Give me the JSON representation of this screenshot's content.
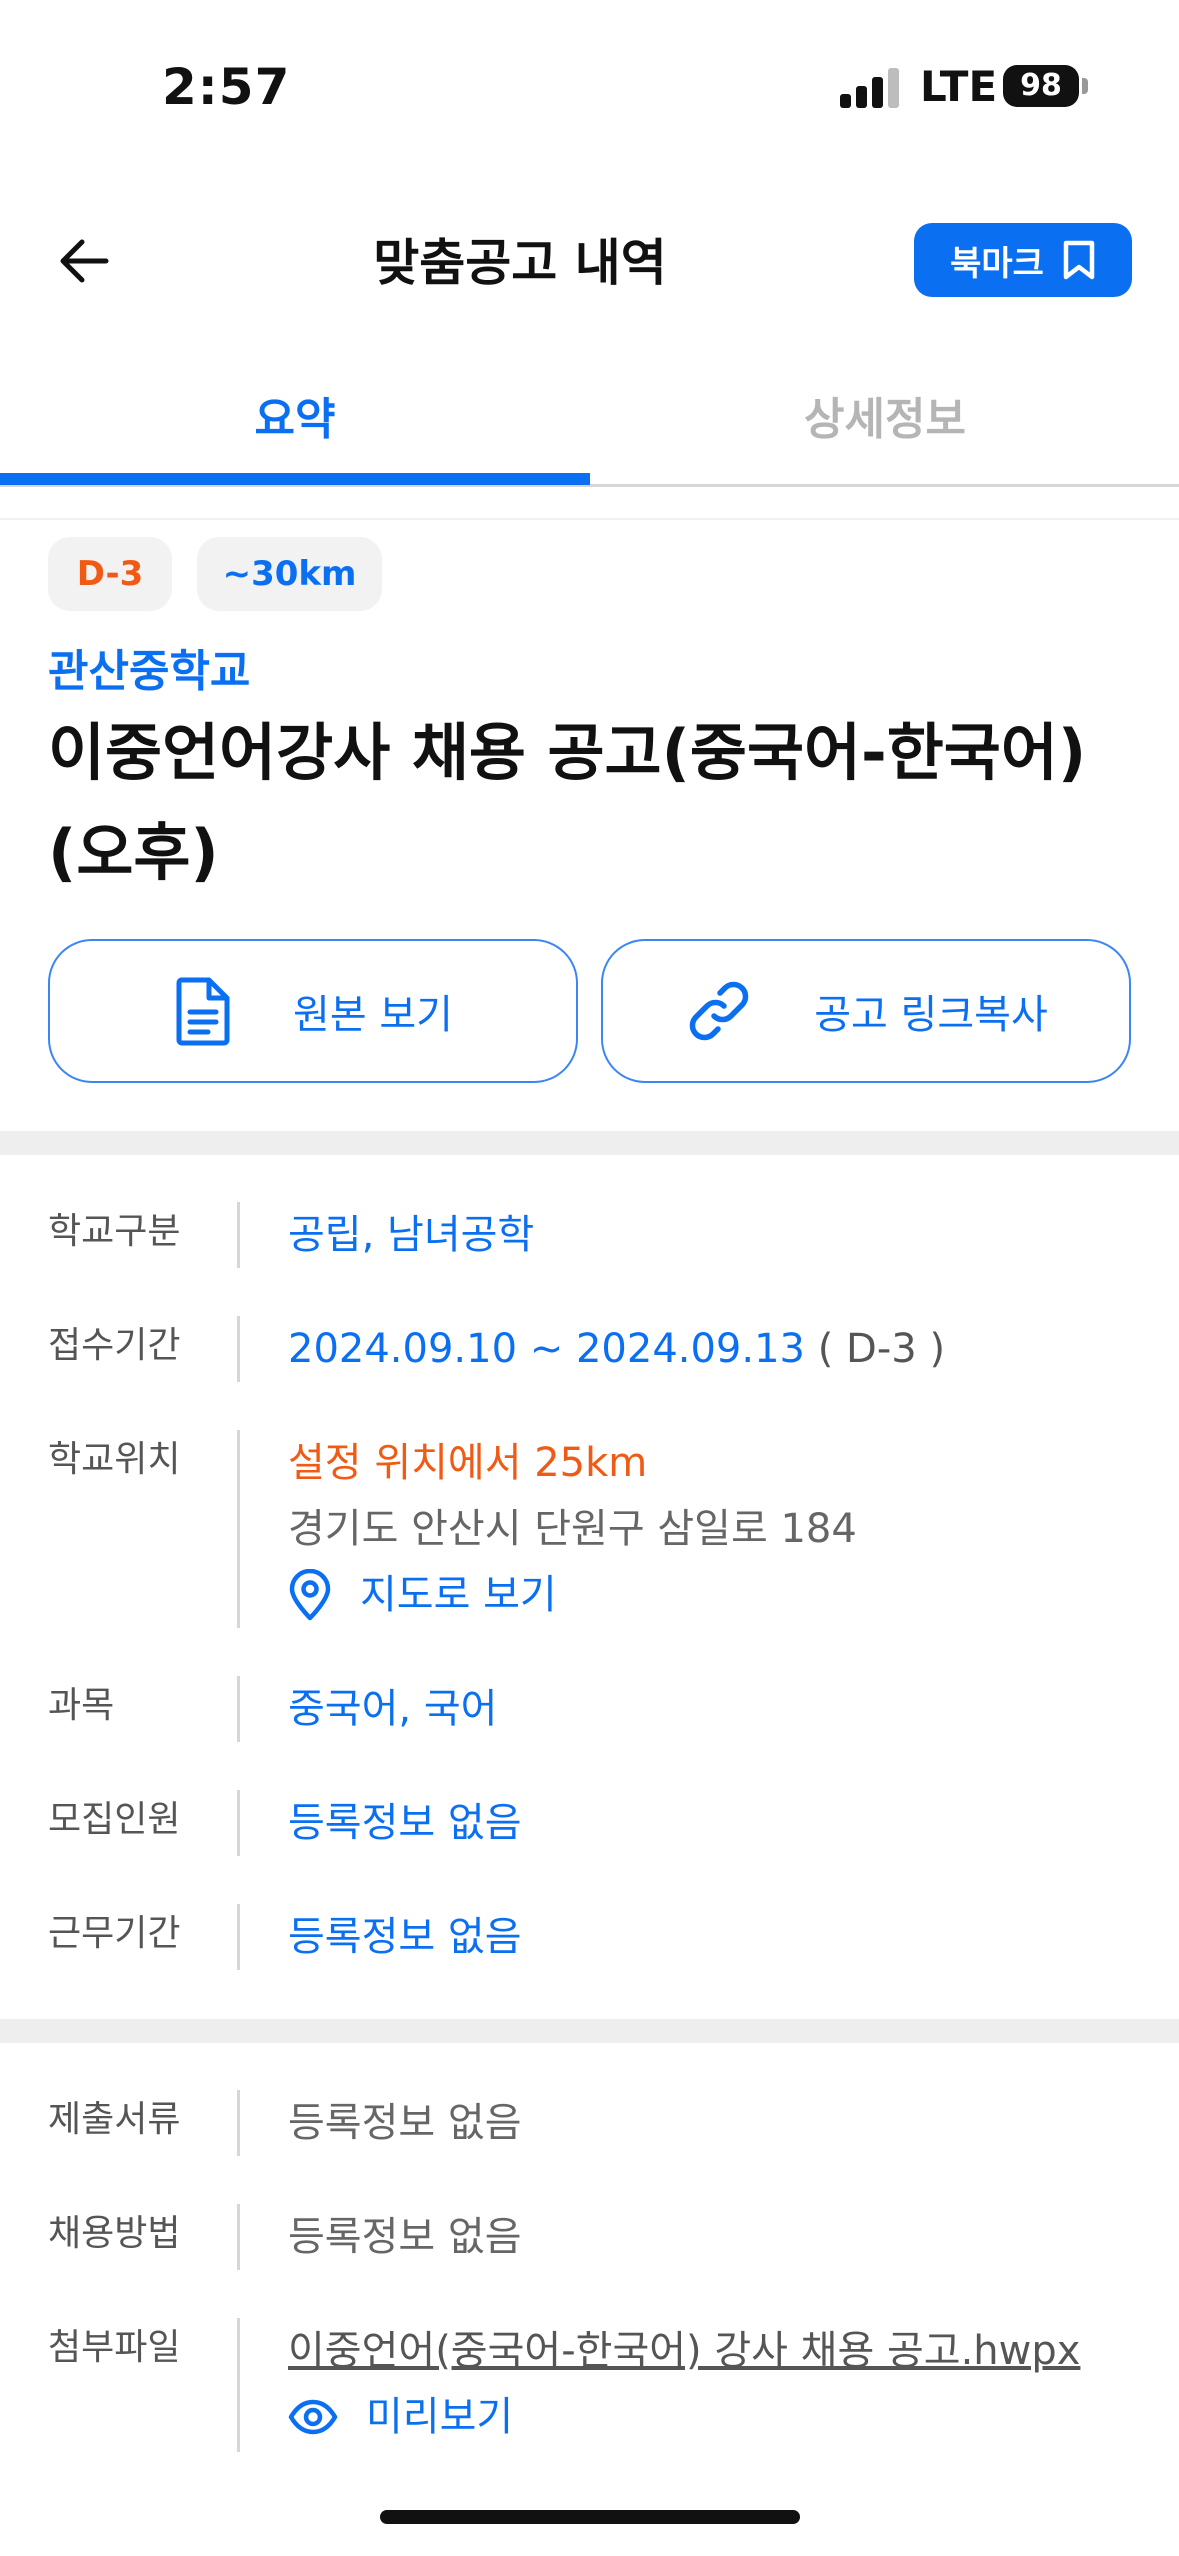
{
  "status": {
    "time": "2:57",
    "network": "LTE",
    "battery": "98"
  },
  "header": {
    "title": "맞춤공고 내역",
    "bookmark_label": "북마크"
  },
  "tabs": [
    {
      "label": "요약",
      "active": true
    },
    {
      "label": "상세정보",
      "active": false
    }
  ],
  "summary": {
    "badges": {
      "dday": "D-3",
      "distance": "~30km"
    },
    "school_name": "관산중학교",
    "title": "이중언어강사 채용 공고(중국어-한국어)(오후)",
    "buttons": {
      "original": "원본 보기",
      "copy_link": "공고 링크복사"
    }
  },
  "info": {
    "school_type": {
      "label": "학교구분",
      "value": "공립, 남녀공학"
    },
    "period": {
      "label": "접수기간",
      "value": "2024.09.10 ~ 2024.09.13",
      "suffix": "( D-3 )"
    },
    "location": {
      "label": "학교위치",
      "distance_text": "설정 위치에서 25km",
      "address": "경기도 안산시 단원구 삼일로 184",
      "map_link": "지도로 보기"
    },
    "subject": {
      "label": "과목",
      "value": "중국어, 국어"
    },
    "headcount": {
      "label": "모집인원",
      "value": "등록정보 없음"
    },
    "work_period": {
      "label": "근무기간",
      "value": "등록정보 없음"
    }
  },
  "extra": {
    "documents": {
      "label": "제출서류",
      "value": "등록정보 없음"
    },
    "method": {
      "label": "채용방법",
      "value": "등록정보 없음"
    },
    "attachment": {
      "label": "첨부파일",
      "file_name": "이중언어(중국어-한국어) 강사 채용 공고.hwpx",
      "preview": "미리보기"
    }
  },
  "colors": {
    "accent": "#0b6ff2",
    "warning": "#f05a14"
  }
}
